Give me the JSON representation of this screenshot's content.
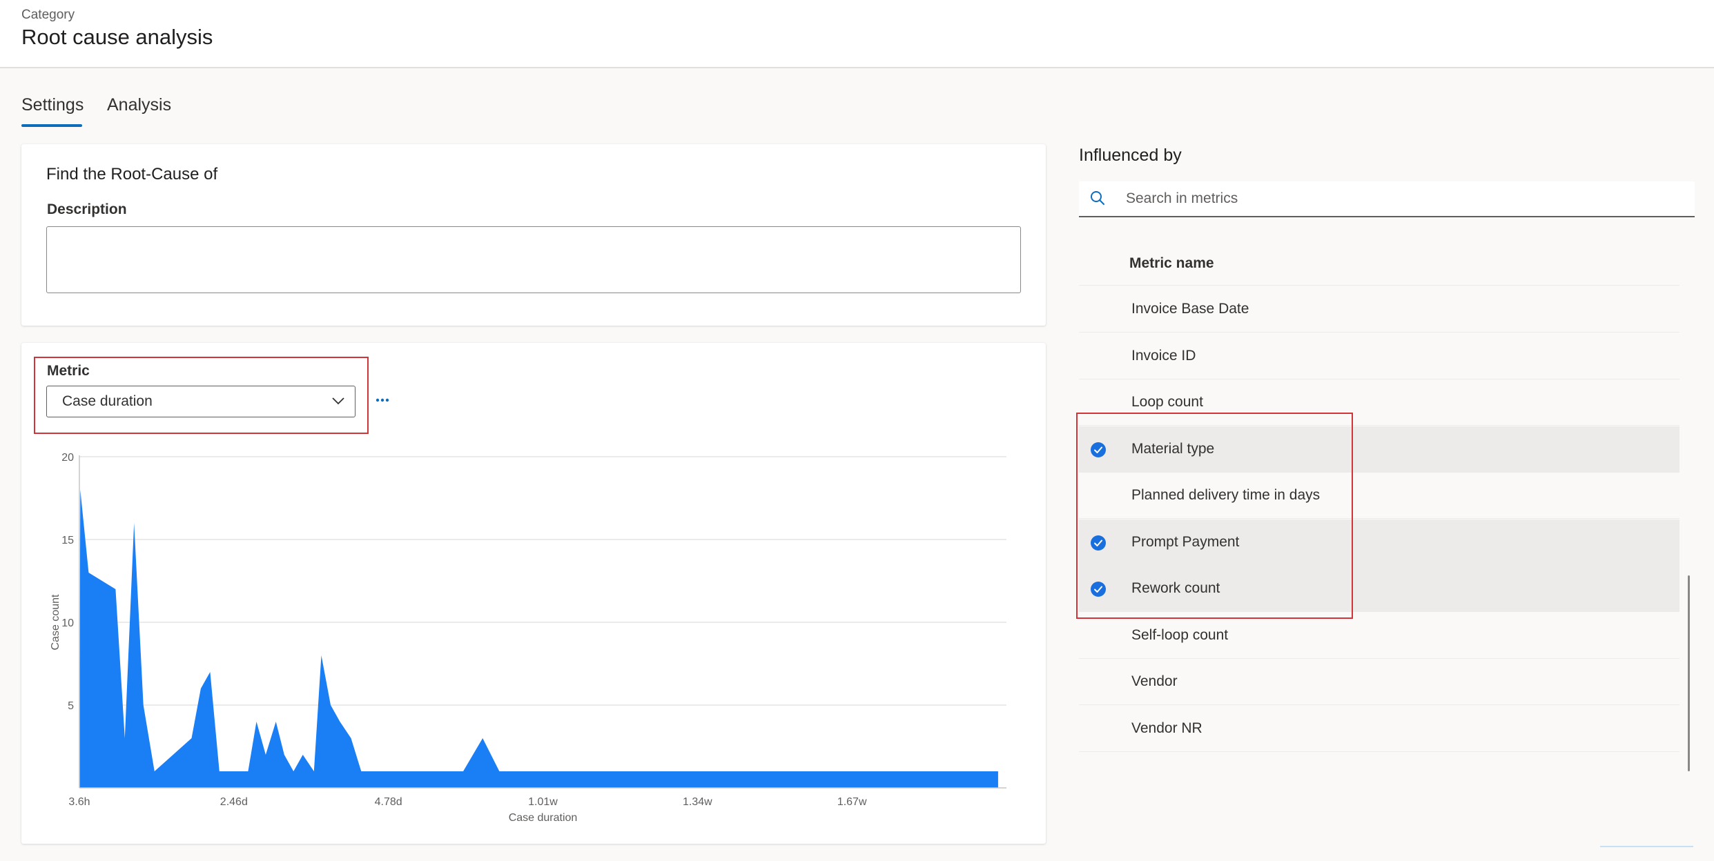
{
  "header": {
    "category_label": "Category",
    "title": "Root cause analysis"
  },
  "tabs": [
    {
      "label": "Settings",
      "active": true
    },
    {
      "label": "Analysis",
      "active": false
    }
  ],
  "root_cause_card": {
    "title": "Find the Root-Cause of",
    "description_label": "Description",
    "description_value": ""
  },
  "metric": {
    "label": "Metric",
    "selected": "Case duration"
  },
  "influenced_by": {
    "title": "Influenced by",
    "search_placeholder": "Search in metrics",
    "column_header": "Metric name",
    "rows": [
      {
        "label": "Invoice Base Date",
        "selected": false
      },
      {
        "label": "Invoice ID",
        "selected": false
      },
      {
        "label": "Loop count",
        "selected": false
      },
      {
        "label": "Material type",
        "selected": true
      },
      {
        "label": "Planned delivery time in days",
        "selected": false
      },
      {
        "label": "Prompt Payment",
        "selected": true
      },
      {
        "label": "Rework count",
        "selected": true
      },
      {
        "label": "Self-loop count",
        "selected": false
      },
      {
        "label": "Vendor",
        "selected": false
      },
      {
        "label": "Vendor NR",
        "selected": false
      }
    ]
  },
  "colors": {
    "accent": "#0f6cbd",
    "chart_fill": "#1a7ef5",
    "highlight_box": "#d13438",
    "check": "#1a6fdf"
  },
  "chart_data": {
    "type": "area",
    "xlabel": "Case duration",
    "ylabel": "Case count",
    "x_tick_labels": [
      "3.6h",
      "2.46d",
      "4.78d",
      "1.01w",
      "1.34w",
      "1.67w"
    ],
    "y_ticks": [
      5,
      10,
      15,
      20
    ],
    "ylim": [
      0,
      20
    ],
    "xlim": [
      0,
      100
    ],
    "grid": true,
    "x": [
      0,
      0.1,
      1,
      3.9,
      4.9,
      5.9,
      6.9,
      8.1,
      12.1,
      13.1,
      14.1,
      15.1,
      18.2,
      19.1,
      20.1,
      21.2,
      22.1,
      23.1,
      24.1,
      25.3,
      26.1,
      27.1,
      28.1,
      29.3,
      30.4,
      32.4,
      33.8,
      36.4,
      41.4,
      43.5,
      45.3,
      99.1,
      99.1
    ],
    "y": [
      0,
      18,
      13,
      12,
      3,
      16,
      5,
      1,
      3,
      6,
      7,
      1,
      1,
      4,
      2,
      4,
      2,
      1,
      2,
      1,
      8,
      5,
      4,
      3,
      1,
      1,
      1,
      1,
      1,
      3,
      1,
      1,
      0
    ]
  }
}
